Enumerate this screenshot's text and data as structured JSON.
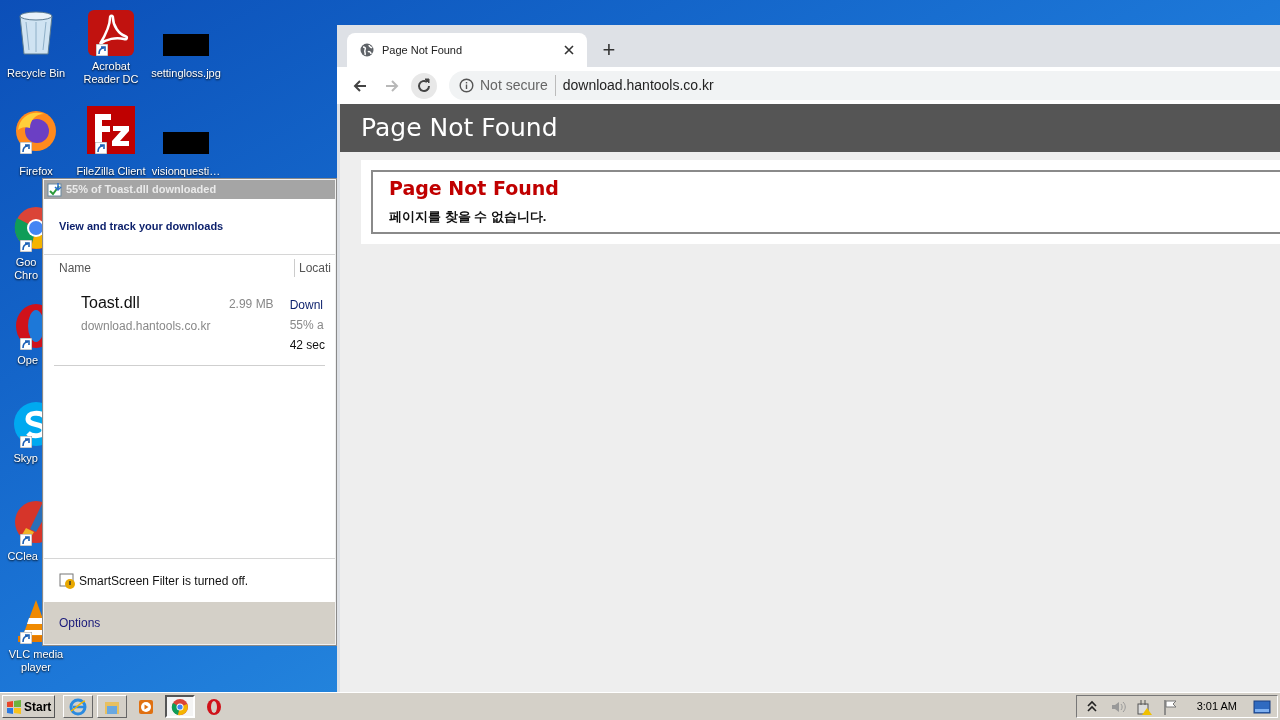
{
  "desktop": {
    "columns": [
      [
        {
          "label": "Recycle Bin",
          "kind": "recycle",
          "shortcut": false
        },
        {
          "label": "Firefox",
          "kind": "firefox",
          "shortcut": true
        },
        {
          "label": "Goo\nChro",
          "kind": "chrome",
          "shortcut": true
        },
        {
          "label": "Ope",
          "kind": "opera",
          "shortcut": true
        },
        {
          "label": "Skyp",
          "kind": "skype",
          "shortcut": true
        },
        {
          "label": "CClea",
          "kind": "ccleaner",
          "shortcut": true
        },
        {
          "label": "VLC media player",
          "kind": "vlc",
          "shortcut": true
        }
      ],
      [
        {
          "label": "Acrobat Reader DC",
          "kind": "pdf",
          "shortcut": true
        },
        {
          "label": "FileZilla Client",
          "kind": "filezilla",
          "shortcut": true
        }
      ],
      [
        {
          "label": "settingloss.jpg",
          "kind": "image",
          "shortcut": false
        },
        {
          "label": "visionquesti…",
          "kind": "image",
          "shortcut": false
        }
      ]
    ]
  },
  "downloads_window": {
    "title": "55% of Toast.dll downloaded",
    "heading": "View and track your downloads",
    "columns": [
      "Name",
      "Locati"
    ],
    "rows": [
      {
        "name": "Toast.dll",
        "size": "2.99 MB",
        "source": "download.hantools.co.kr",
        "location_lines": [
          "Downl",
          "55% a",
          "42 sec"
        ]
      }
    ],
    "smartscreen": "SmartScreen Filter is turned off.",
    "options": "Options"
  },
  "browser": {
    "tabs": [
      {
        "label": "Page Not Found",
        "selected": true
      }
    ],
    "new_tab": "+",
    "nav": [
      {
        "kind": "back",
        "disabled": false
      },
      {
        "kind": "forward",
        "disabled": true
      },
      {
        "kind": "reload",
        "disabled": false
      }
    ],
    "security": "Not secure",
    "url": "download.hantools.co.kr",
    "page": {
      "header": "Page Not Found",
      "box_title": "Page Not Found",
      "message": "페이지를 찾을 수 없습니다."
    }
  },
  "taskbar": {
    "start": "Start",
    "items": [
      {
        "kind": "ie",
        "selected": false
      },
      {
        "kind": "explorer",
        "selected": false
      },
      {
        "kind": "media",
        "selected": false
      },
      {
        "kind": "chrome",
        "selected": true
      },
      {
        "kind": "opera",
        "selected": false
      }
    ],
    "tray": [
      {
        "kind": "chevron"
      },
      {
        "kind": "speaker"
      },
      {
        "kind": "network"
      },
      {
        "kind": "flag"
      }
    ],
    "clock": "3:01 AM"
  }
}
